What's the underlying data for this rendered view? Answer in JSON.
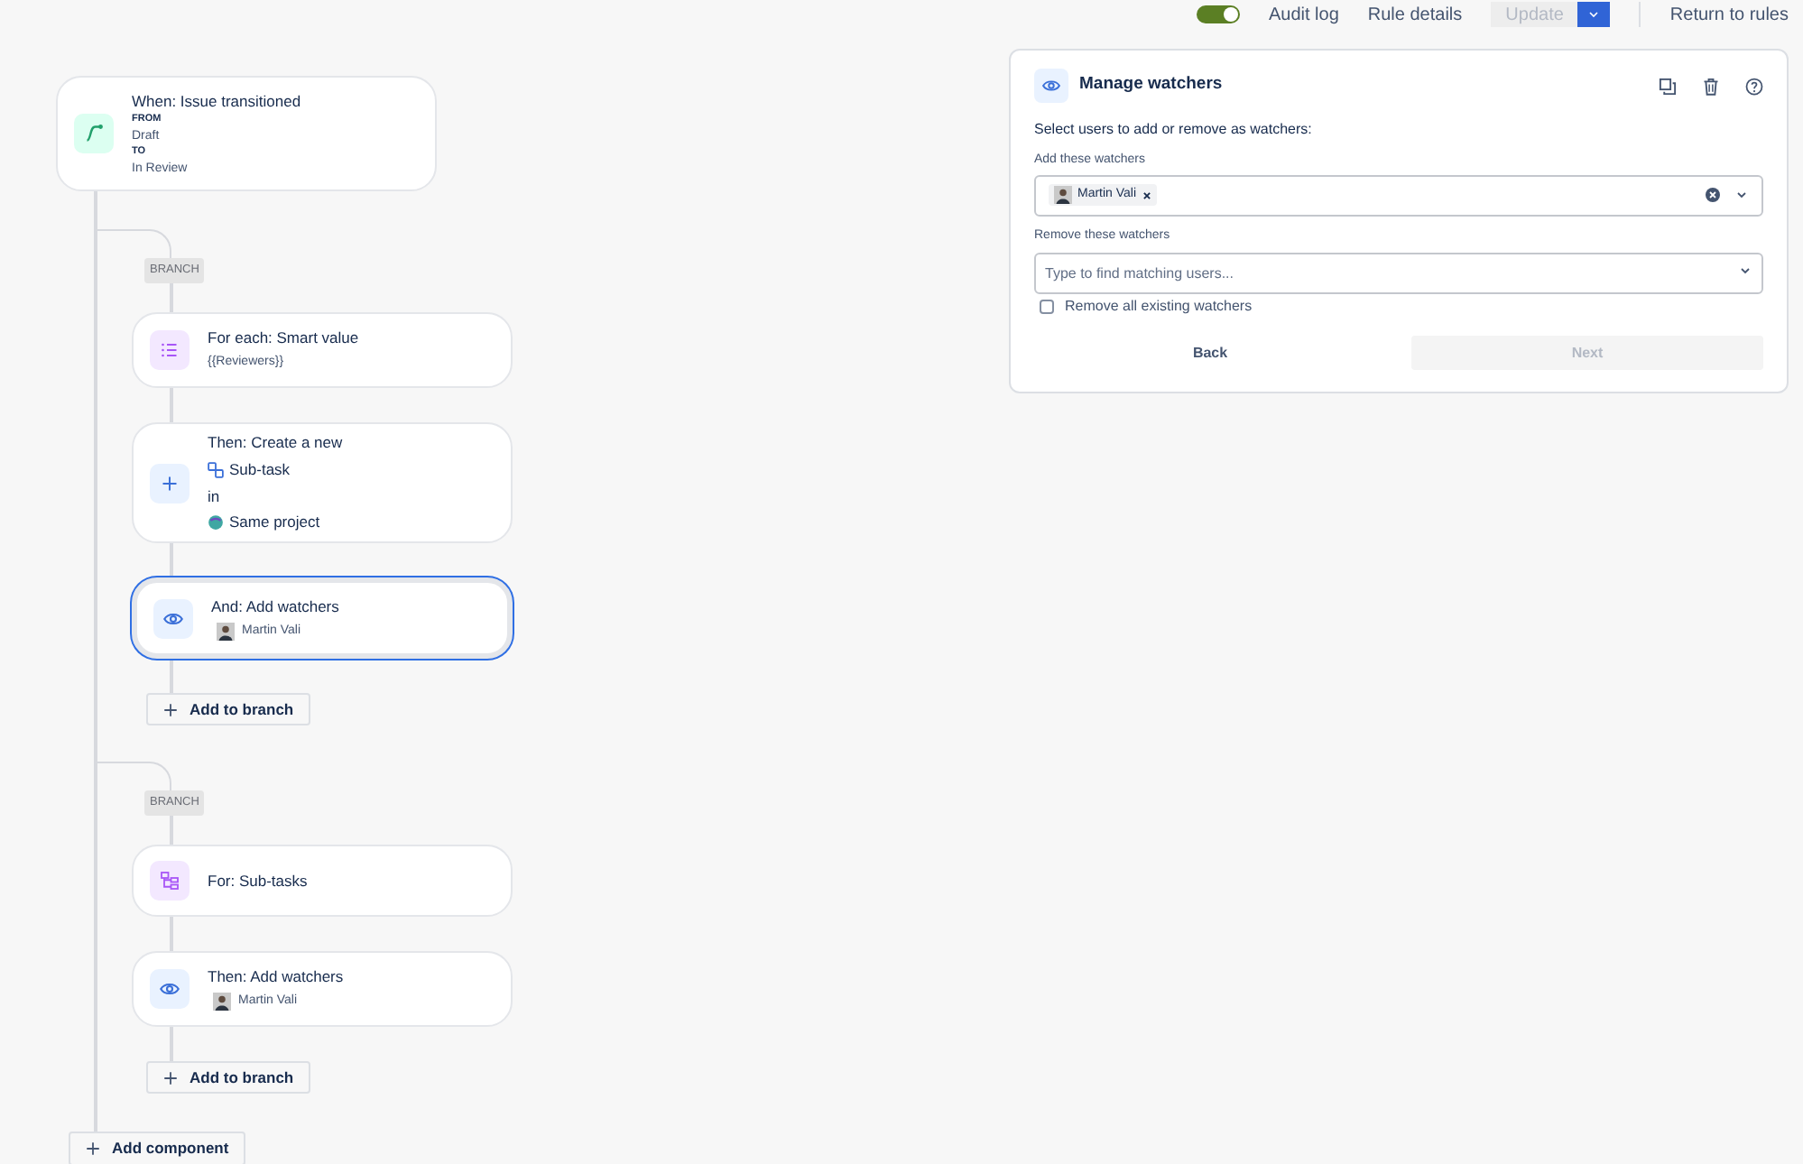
{
  "top_bar": {
    "toggle": {
      "on": true
    },
    "links": [
      "Audit log",
      "Rule details"
    ],
    "update_button": {
      "label": "Update",
      "disabled": true
    },
    "return_link": "Return to rules"
  },
  "trigger": {
    "title": "When: Issue transitioned",
    "from_label": "FROM",
    "from": "Draft",
    "to_label": "TO",
    "to": "In Review"
  },
  "branches": [
    {
      "label": "BRANCH",
      "components": [
        {
          "kind": "for_each",
          "title": "For each: Smart value",
          "detail": "{{Reviewers}}",
          "selected": false
        },
        {
          "kind": "create",
          "title": "Then: Create a new",
          "issue_type": "Sub-task",
          "in": "in",
          "project": "Same project",
          "selected": false
        },
        {
          "kind": "watchers",
          "title": "And: Add watchers",
          "user": "Martin Vali",
          "selected": true
        }
      ],
      "add_button": "Add to branch"
    },
    {
      "label": "BRANCH",
      "components": [
        {
          "kind": "subtasks",
          "title": "For: Sub-tasks",
          "selected": false
        },
        {
          "kind": "watchers",
          "title": "Then: Add watchers",
          "user": "Martin Vali",
          "selected": false
        }
      ],
      "add_button": "Add to branch"
    }
  ],
  "add_component": "Add component",
  "panel": {
    "title": "Manage watchers",
    "intro": "Select users to add or remove as watchers:",
    "add_field": {
      "label": "Add these watchers",
      "users": [
        "Martin Vali"
      ]
    },
    "remove_field": {
      "label": "Remove these watchers",
      "placeholder": "Type to find matching users..."
    },
    "remove_all": {
      "label": "Remove all existing watchers",
      "checked": false
    },
    "back_button": "Back",
    "next_button": {
      "label": "Next",
      "disabled": true
    }
  }
}
